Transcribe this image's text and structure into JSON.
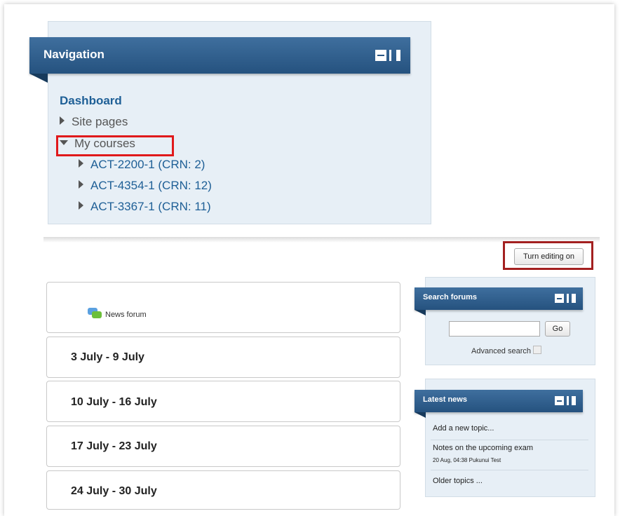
{
  "navigation": {
    "title": "Navigation",
    "dashboard": "Dashboard",
    "site_pages": "Site pages",
    "my_courses": "My courses",
    "courses": [
      "ACT-2200-1 (CRN: 2)",
      "ACT-4354-1 (CRN: 12)",
      "ACT-3367-1 (CRN: 11)"
    ]
  },
  "edit_button": "Turn editing on",
  "sections": {
    "news_forum": "News forum",
    "weeks": [
      "3 July - 9 July",
      "10 July - 16 July",
      "17 July - 23 July",
      "24 July - 30 July"
    ]
  },
  "search_forums": {
    "title": "Search forums",
    "go": "Go",
    "advanced": "Advanced search"
  },
  "latest_news": {
    "title": "Latest news",
    "add_topic": "Add a new topic...",
    "item_title": "Notes on the upcoming exam",
    "item_meta": "20 Aug, 04:38  Pukunui Test",
    "older": "Older topics ..."
  },
  "colors": {
    "header_blue": "#2b5784",
    "link_blue": "#1e5f96",
    "block_bg": "#e7eff6",
    "highlight_red": "#e0191b"
  }
}
